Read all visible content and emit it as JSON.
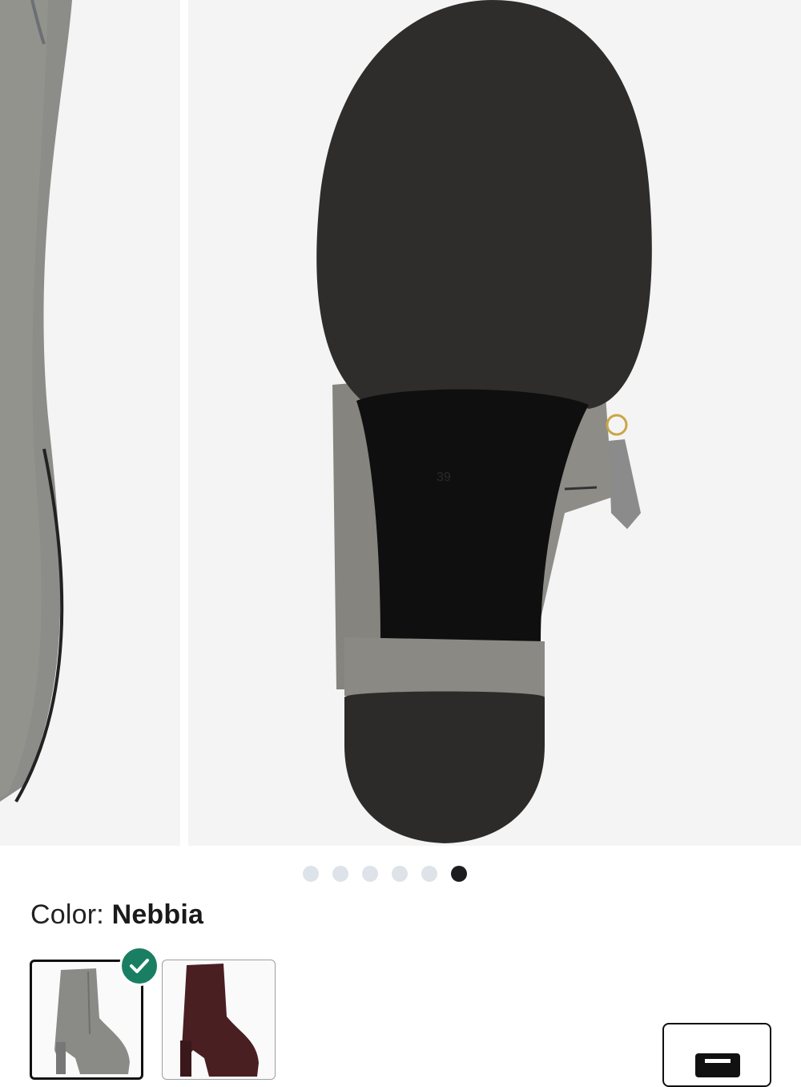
{
  "gallery": {
    "image_count": 6,
    "active_index": 5,
    "slides": [
      "product-side-view",
      "product-sole-view"
    ]
  },
  "color": {
    "label": "Color:",
    "value": "Nebbia"
  },
  "swatches": [
    {
      "name": "Nebbia",
      "color": "#8a8a86",
      "selected": true
    },
    {
      "name": "burgundy",
      "color": "#4a1f22",
      "selected": false
    }
  ],
  "colors": {
    "check_badge": "#1a7f62",
    "dot_inactive": "#dde3e8",
    "dot_active": "#1d1d1f"
  }
}
